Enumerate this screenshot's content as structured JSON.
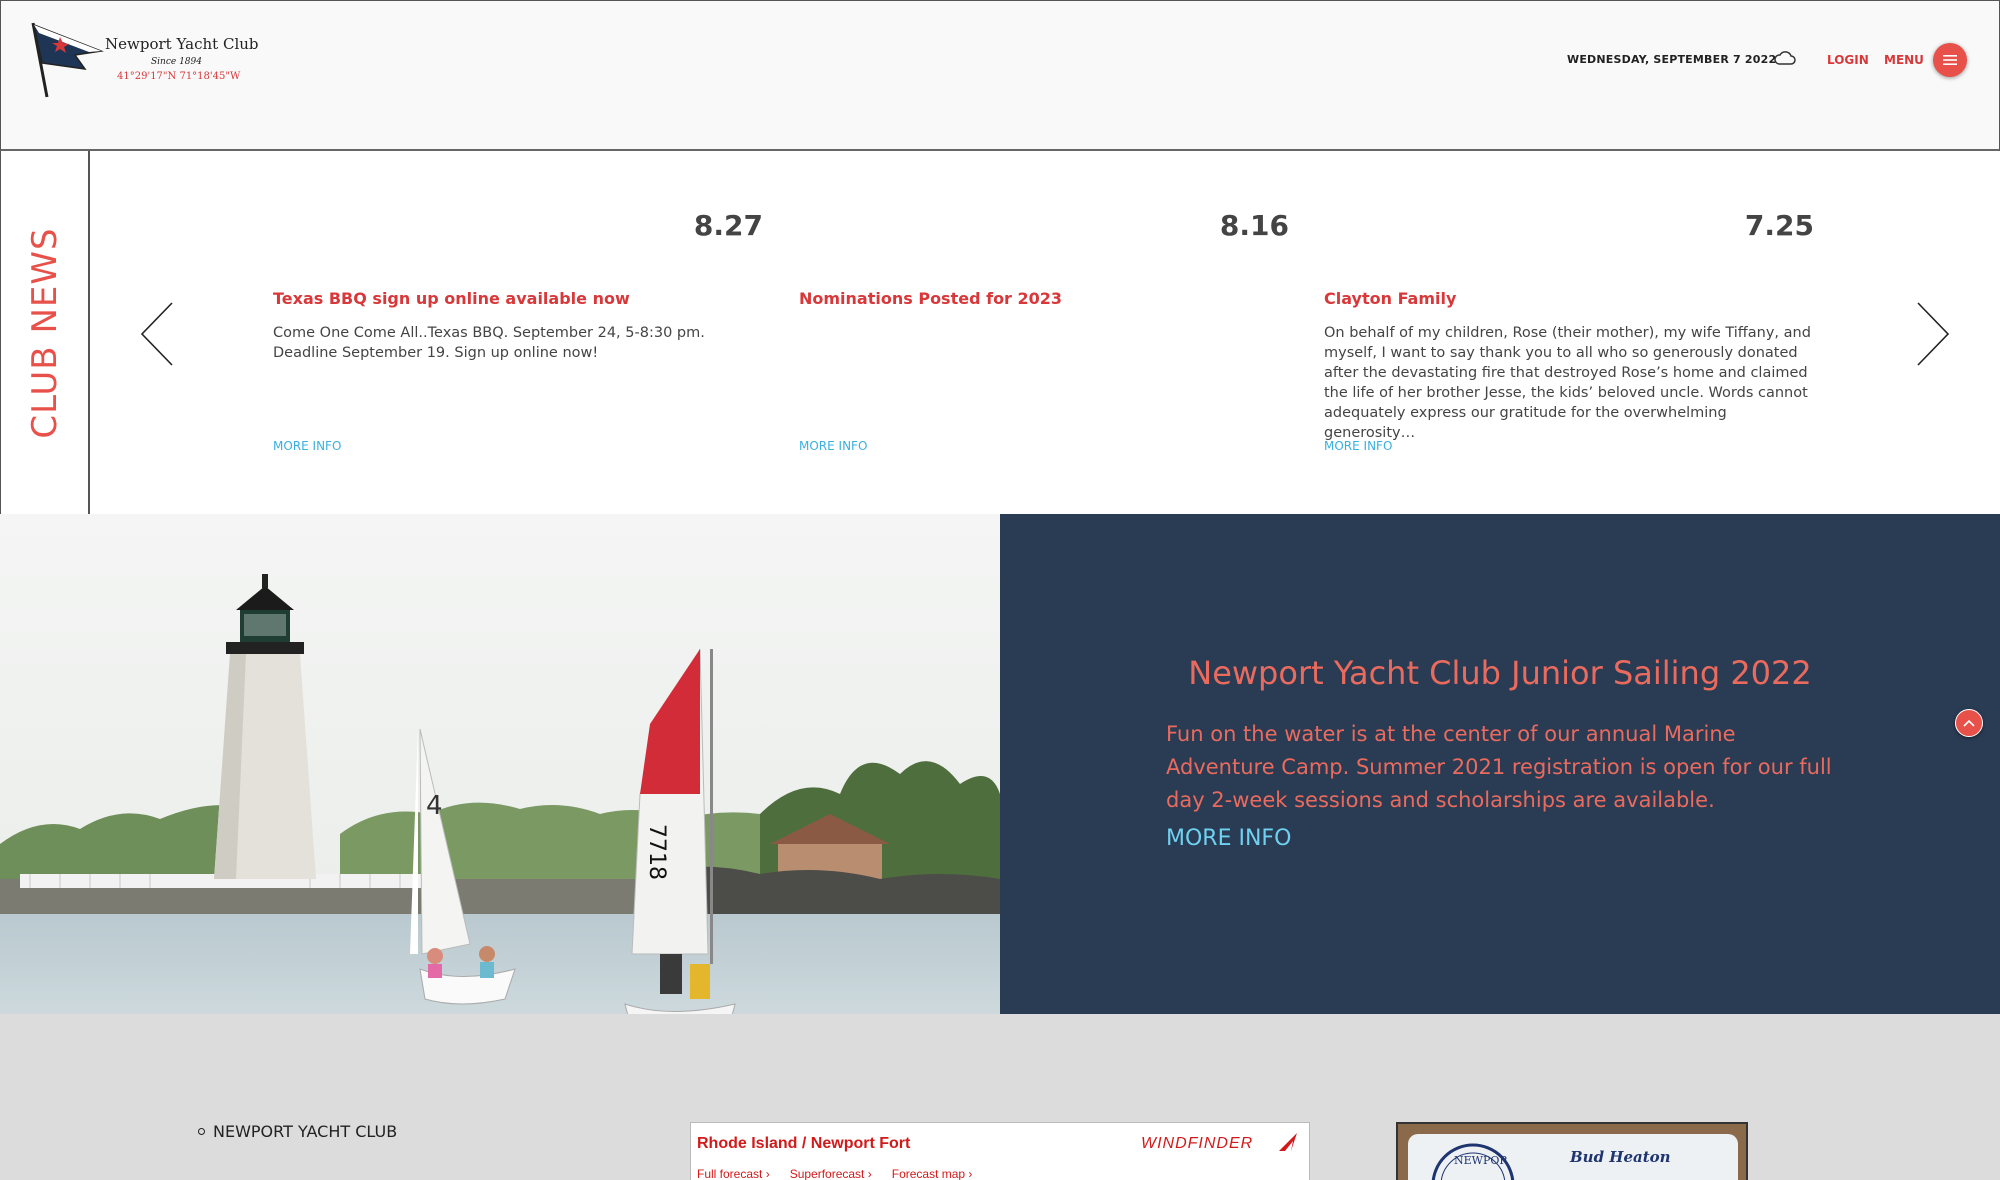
{
  "header": {
    "logo": {
      "name": "Newport Yacht Club",
      "since": "Since 1894",
      "coords": "41°29'17\"N 71°18'45\"W"
    },
    "date": "WEDNESDAY, SEPTEMBER 7 2022",
    "weather_icon": "cloud-icon",
    "login_label": "LOGIN",
    "menu_label": "MENU",
    "menu_icon": "hamburger-icon",
    "colors": {
      "accent": "#e8514a",
      "bg": "#f9f9f9"
    }
  },
  "news": {
    "section_label": "CLUB NEWS",
    "prev_icon": "chevron-left-icon",
    "next_icon": "chevron-right-icon",
    "items": [
      {
        "date": "8.27",
        "title": "Texas BBQ sign up online available now",
        "body": "Come One Come All..Texas BBQ.  September 24, 5-8:30 pm.\n Deadline September 19. Sign up online now!",
        "more": "MORE INFO"
      },
      {
        "date": "8.16",
        "title": "Nominations Posted for 2023",
        "body": "",
        "more": "MORE INFO"
      },
      {
        "date": "7.25",
        "title": "Clayton Family",
        "body": "On behalf of my children, Rose (their mother), my wife Tiffany, and myself, I want to say thank you to all who so generously donated after the devastating fire that destroyed Rose’s home and claimed the life of her brother Jesse, the kids’ beloved uncle. Words cannot adequately express our gratitude for the overwhelming generosity…",
        "more": "MORE INFO"
      }
    ]
  },
  "hero": {
    "title": "Newport Yacht Club Junior Sailing 2022",
    "text": "Fun on the water is at the center of our annual Marine Adventure Camp. Summer 2021 registration is open for our full day 2-week sessions and scholarships are available.",
    "more": "MORE INFO",
    "photo_boat1_sail": "4",
    "photo_boat2_sail": "7718",
    "scroll_top_icon": "chevron-up-icon",
    "colors": {
      "panel": "#2a3b54",
      "text": "#ea6b5e",
      "link": "#6fd1f0"
    }
  },
  "footer": {
    "club_link": "NEWPORT YACHT CLUB",
    "windfinder": {
      "title": "Rhode Island / Newport Fort",
      "brand": "WINDFINDER",
      "links": [
        "Full forecast ›",
        "Superforecast ›",
        "Forecast map ›"
      ]
    },
    "card": {
      "seal_text": "NEWPOR",
      "name": "Bud Heaton"
    }
  }
}
